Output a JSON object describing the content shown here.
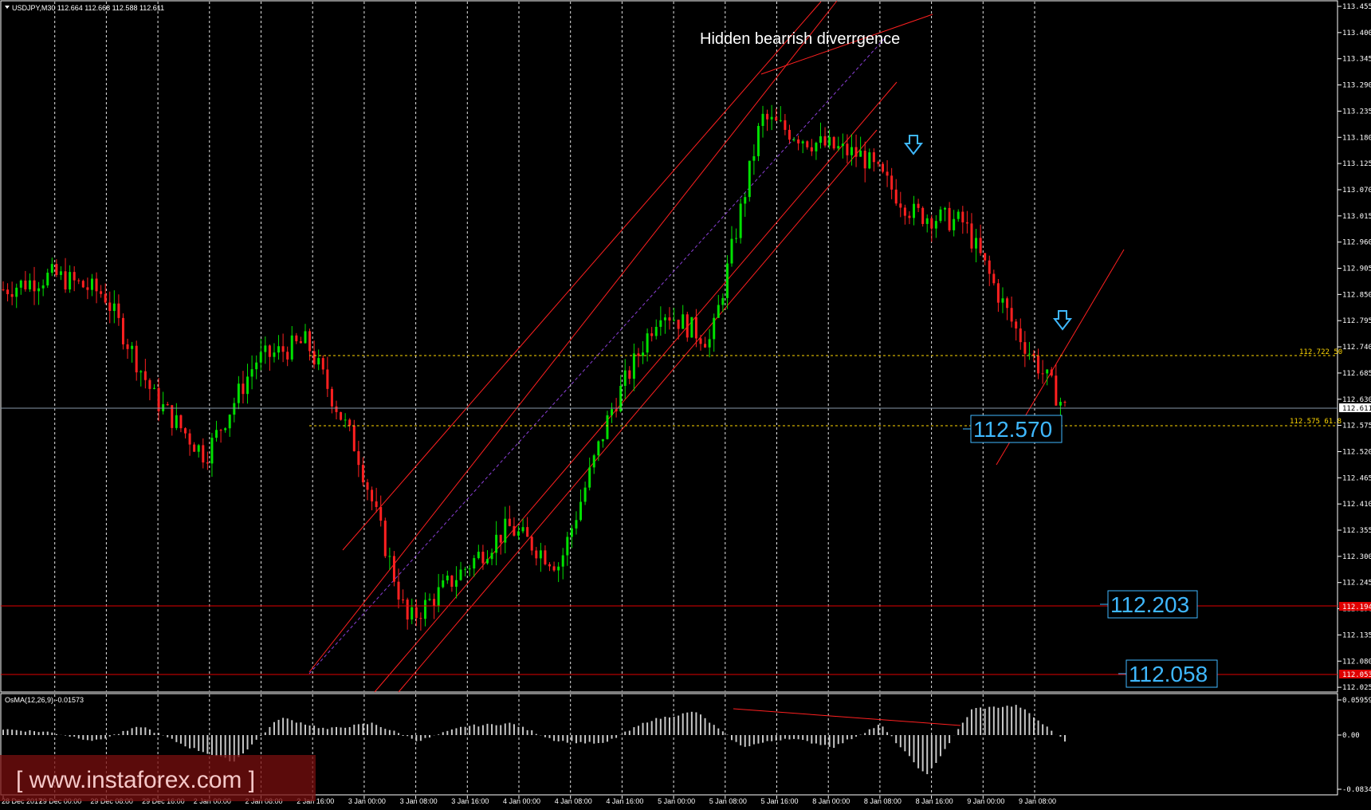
{
  "header": {
    "symbol_label": "USDJPY,M30  112.664 112.668 112.588 112.611",
    "osma_label": "OsMA(12,26,9) -0.01573"
  },
  "annotation": {
    "text": "Hidden bearrish diverrgence"
  },
  "price_axis": {
    "labels": [
      "113.455",
      "113.400",
      "113.345",
      "113.290",
      "113.235",
      "113.180",
      "113.125",
      "113.070",
      "113.015",
      "112.960",
      "112.905",
      "112.850",
      "112.795",
      "112.740",
      "112.685",
      "112.630",
      "112.575",
      "112.520",
      "112.465",
      "112.410",
      "112.355",
      "112.300",
      "112.245",
      "112.190",
      "112.135",
      "112.080",
      "112.025"
    ],
    "current_price": "112.611",
    "red_tag_1": "112.194",
    "red_tag_2": "112.053"
  },
  "osma_axis": {
    "labels": [
      "0.05959",
      "0.00",
      "-0.08345"
    ]
  },
  "time_axis": {
    "labels": [
      "28 Dec 2017",
      "29 Dec 00:00",
      "29 Dec 08:00",
      "29 Dec 16:00",
      "2 Jan 00:00",
      "2 Jan 08:00",
      "2 Jan 16:00",
      "3 Jan 00:00",
      "3 Jan 08:00",
      "3 Jan 16:00",
      "4 Jan 00:00",
      "4 Jan 08:00",
      "4 Jan 16:00",
      "5 Jan 00:00",
      "5 Jan 08:00",
      "5 Jan 16:00",
      "8 Jan 00:00",
      "8 Jan 08:00",
      "8 Jan 16:00",
      "9 Jan 00:00",
      "9 Jan 08:00"
    ]
  },
  "levels": {
    "fib1_label": "112.722  50",
    "fib2_label": "112.575  61.8",
    "box1": "112.570",
    "box2": "112.203",
    "box3": "112.058"
  },
  "watermark": {
    "text": "[ www.instaforex.com ]"
  },
  "colors": {
    "bull": "#00e000",
    "bear": "#ff2020",
    "channel": "#ff2020",
    "fib": "#ffd700",
    "box": "#3fb8ff",
    "osma": "#c8c8c8",
    "grid": "#ffffff",
    "current": "#8899aa",
    "midline": "#8a3fd6"
  },
  "chart_data": {
    "type": "line",
    "title": "USDJPY,M30",
    "ylim": [
      112.02,
      113.46
    ],
    "x": [
      "28 Dec 2017",
      "29 Dec 00:00",
      "29 Dec 08:00",
      "29 Dec 16:00",
      "2 Jan 00:00",
      "2 Jan 08:00",
      "2 Jan 16:00",
      "3 Jan 00:00",
      "3 Jan 08:00",
      "3 Jan 16:00",
      "4 Jan 00:00",
      "4 Jan 08:00",
      "4 Jan 16:00",
      "5 Jan 00:00",
      "5 Jan 08:00",
      "5 Jan 16:00",
      "8 Jan 00:00",
      "8 Jan 08:00",
      "8 Jan 16:00",
      "9 Jan 00:00",
      "9 Jan 08:00",
      "9 Jan 12:00"
    ],
    "series": [
      {
        "values": [
          112.86,
          112.89,
          112.85,
          112.63,
          112.51,
          112.71,
          112.75,
          112.52,
          112.16,
          112.26,
          112.36,
          112.28,
          112.6,
          112.82,
          112.75,
          113.22,
          113.17,
          113.14,
          113.02,
          113.0,
          112.78,
          112.61
        ]
      }
    ],
    "levels": [
      112.722,
      112.575,
      112.194,
      112.053,
      112.611
    ],
    "osma": {
      "ylim": [
        -0.08345,
        0.05959
      ],
      "values": [
        0.01,
        0.005,
        -0.01,
        0.015,
        -0.02,
        -0.045,
        0.03,
        0.01,
        0.02,
        -0.01,
        0.015,
        0.02,
        -0.01,
        -0.015,
        0.025,
        0.04,
        -0.02,
        -0.005,
        -0.02,
        0.018,
        -0.07,
        0.045,
        0.05,
        -0.01
      ]
    }
  }
}
